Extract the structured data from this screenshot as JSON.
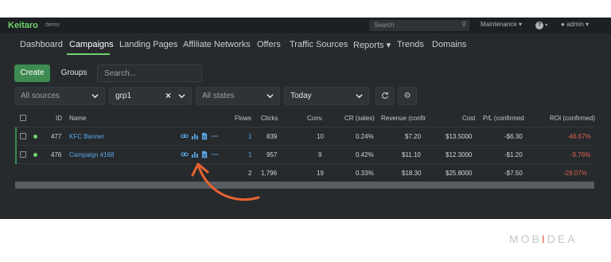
{
  "topbar": {
    "logo": "Keitaro",
    "logo_sub": "demo",
    "search_placeholder": "Search",
    "maintenance": "Maintenance ▾",
    "help": "?",
    "user": "admin ▾"
  },
  "nav": [
    "Dashboard",
    "Campaigns",
    "Landing Pages",
    "Affiliate Networks",
    "Offers",
    "Traffic Sources",
    "Reports ▾",
    "Trends",
    "Domains"
  ],
  "toolbar": {
    "create": "Create",
    "groups": "Groups",
    "search_placeholder": "Search..."
  },
  "filters": {
    "sources": "All sources",
    "group": "grp1",
    "states": "All states",
    "period": "Today"
  },
  "table": {
    "headers": {
      "id": "ID",
      "name": "Name",
      "flows": "Flows",
      "clicks": "Clicks",
      "conv": "Conv.",
      "cr": "CR (sales)",
      "revenue": "Revenue (confir",
      "cost": "Cost",
      "pl": "P/L (confirmed",
      "roi": "ROI (confirmed)"
    },
    "rows": [
      {
        "id": "477",
        "name": "KFC Banner",
        "flows": "1",
        "clicks": "839",
        "conv": "10",
        "cr": "0.24%",
        "revenue": "$7.20",
        "cost": "$13.5000",
        "pl": "-$6.30",
        "roi": "-46.67%"
      },
      {
        "id": "476",
        "name": "Campaign #168",
        "flows": "1",
        "clicks": "957",
        "conv": "9",
        "cr": "0.42%",
        "revenue": "$11.10",
        "cost": "$12.3000",
        "pl": "-$1.20",
        "roi": "-9.76%"
      }
    ],
    "totals": {
      "flows": "2",
      "clicks": "1,796",
      "conv": "19",
      "cr": "0.33%",
      "revenue": "$18.30",
      "cost": "$25.8000",
      "pl": "-$7.50",
      "roi": "-29.07%"
    }
  },
  "brand": {
    "part1": "MOB",
    "part2": "I",
    "part3": "DEA"
  },
  "colors": {
    "accent": "#6fd36a",
    "create": "#3d8b50",
    "link": "#5aa6e6",
    "negative": "#e0624f",
    "arrow": "#e8632f"
  }
}
